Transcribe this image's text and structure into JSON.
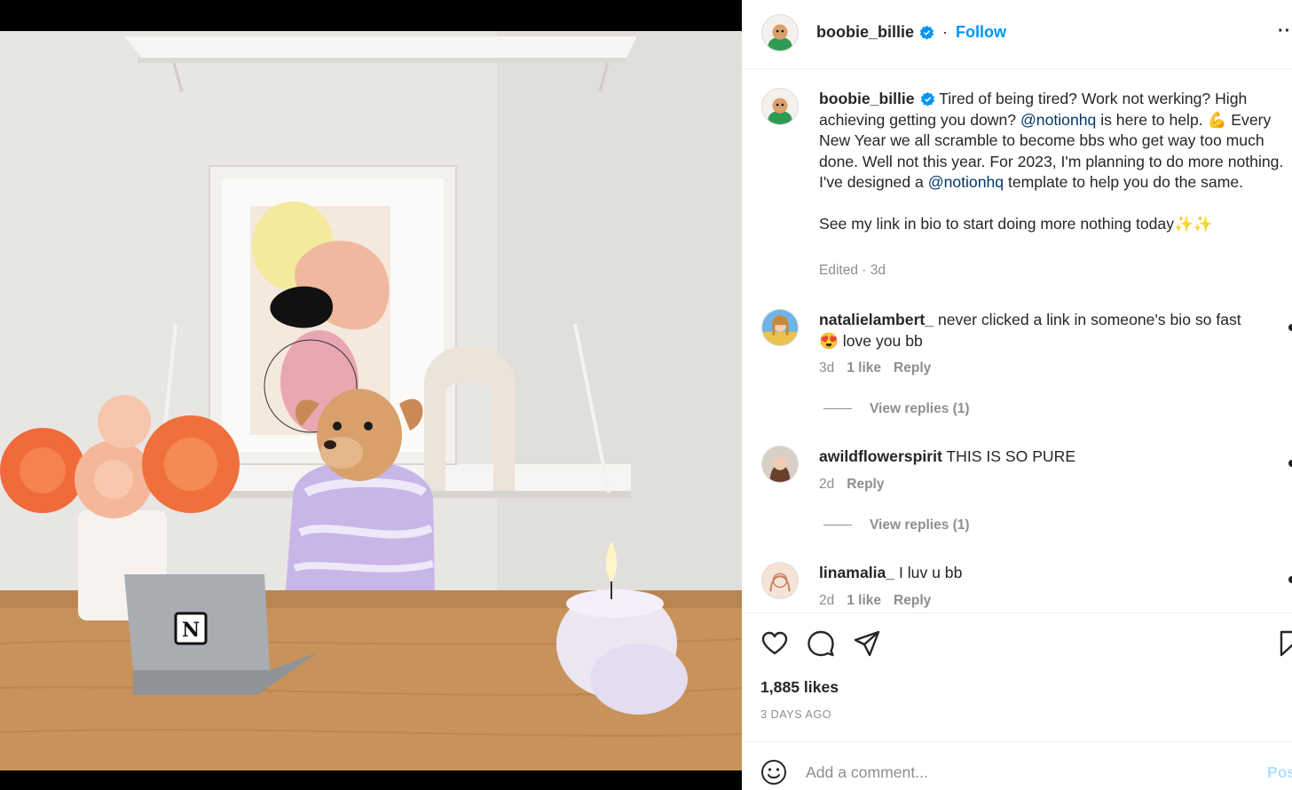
{
  "post": {
    "username": "boobie_billie",
    "verified": true,
    "follow_label": "Follow",
    "separator": "·",
    "more_label": "··",
    "image_alt": "Chihuahua in a lilac sweater sitting at a wooden desk with a laptop, roses and a candle",
    "laptop_logo": "N"
  },
  "caption": {
    "username": "boobie_billie",
    "text_1": "Tired of being tired? Work not werking? High achieving getting you down?",
    "mention_1": "@notionhq",
    "text_2": "is here to help. 💪 Every New Year we all scramble to become bbs who get way too much done. Well not this year. For 2023, I'm planning to do more nothing. I've designed a",
    "mention_2": "@notionhq",
    "text_3": "template to help you do the same.",
    "text_4": "See my link in bio to start doing more nothing today✨✨",
    "meta": "Edited · 3d"
  },
  "comments": [
    {
      "username": "natalielambert_",
      "text": "never clicked a link in someone's bio so fast 😍 love you bb",
      "time": "3d",
      "likes": "1 like",
      "reply_label": "Reply",
      "view_replies": "View replies (1)"
    },
    {
      "username": "awildflowerspirit",
      "text": "THIS IS SO PURE",
      "time": "2d",
      "reply_label": "Reply",
      "view_replies": "View replies (1)"
    },
    {
      "username": "linamalia_",
      "text": "I luv u bb",
      "time": "2d",
      "likes": "1 like",
      "reply_label": "Reply"
    }
  ],
  "actions": {
    "likes": "1,885 likes",
    "timestamp": "3 DAYS AGO",
    "icons": [
      "heart-icon",
      "comment-icon",
      "share-icon",
      "bookmark-icon"
    ]
  },
  "add_comment": {
    "placeholder": "Add a comment...",
    "post_label": "Post",
    "emoji_icon": "emoji-icon"
  },
  "colors": {
    "link_blue": "#0095f6",
    "mention_blue": "#00376b",
    "secondary_text": "#8e8e8e",
    "post_disabled": "#b2dffc"
  }
}
